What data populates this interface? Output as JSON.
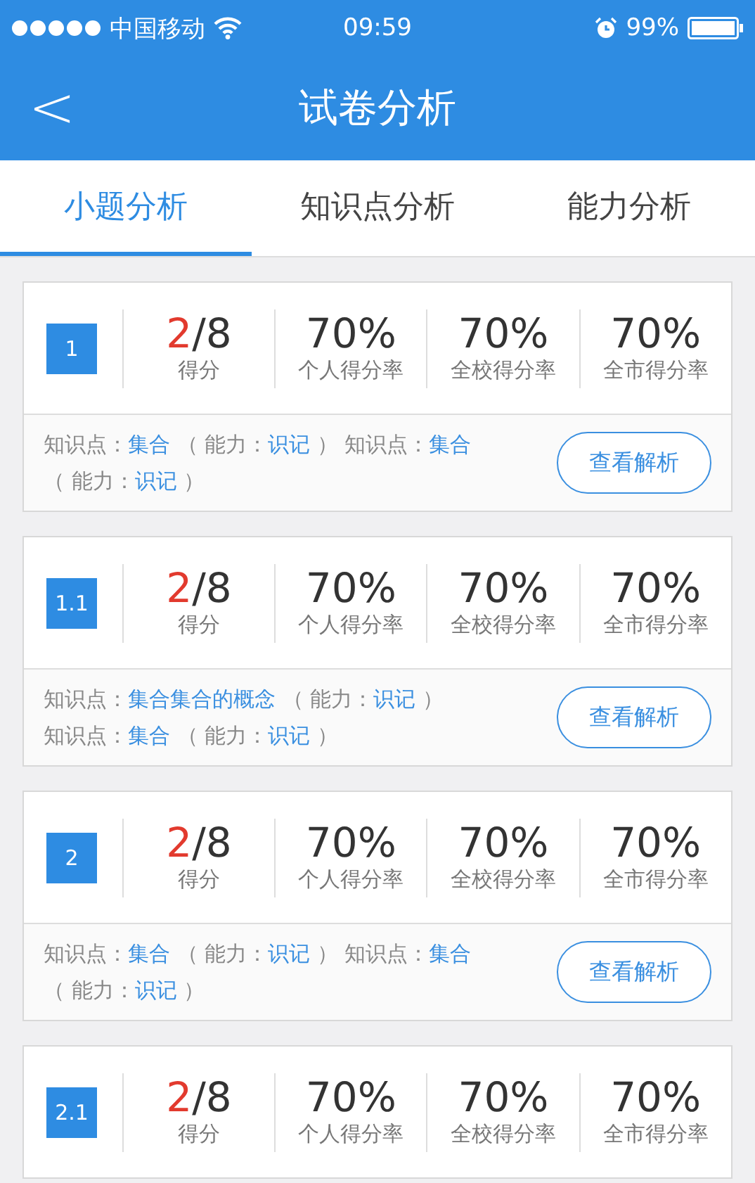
{
  "status_bar": {
    "carrier": "中国移动",
    "time": "09:59",
    "battery": "99%"
  },
  "nav": {
    "back": "<",
    "title": "试卷分析"
  },
  "tabs": [
    {
      "label": "小题分析",
      "selected": true
    },
    {
      "label": "知识点分析",
      "selected": false
    },
    {
      "label": "能力分析",
      "selected": false
    }
  ],
  "questions": [
    {
      "number": "1",
      "score": "2",
      "max": "/8",
      "score_label": "得分",
      "stats": [
        {
          "value": "70%",
          "label": "个人得分率"
        },
        {
          "value": "70%",
          "label": "全校得分率"
        },
        {
          "value": "70%",
          "label": "全市得分率"
        }
      ],
      "lines": [
        [
          {
            "text": "知识点：",
            "kind": "label"
          },
          {
            "text": "集合",
            "kind": "value"
          },
          {
            "text": " （ 能力：",
            "kind": "label"
          },
          {
            "text": "识记",
            "kind": "value"
          },
          {
            "text": " ） 知识点：",
            "kind": "label"
          },
          {
            "text": "集合",
            "kind": "value"
          }
        ],
        [
          {
            "text": "（ 能力：",
            "kind": "label"
          },
          {
            "text": "识记",
            "kind": "value"
          },
          {
            "text": " ）",
            "kind": "label"
          }
        ]
      ],
      "button": "查看解析"
    },
    {
      "number": "1.1",
      "score": "2",
      "max": "/8",
      "score_label": "得分",
      "stats": [
        {
          "value": "70%",
          "label": "个人得分率"
        },
        {
          "value": "70%",
          "label": "全校得分率"
        },
        {
          "value": "70%",
          "label": "全市得分率"
        }
      ],
      "lines": [
        [
          {
            "text": "知识点：",
            "kind": "label"
          },
          {
            "text": "集合集合的概念",
            "kind": "value"
          },
          {
            "text": " （ 能力：",
            "kind": "label"
          },
          {
            "text": "识记",
            "kind": "value"
          },
          {
            "text": " ）",
            "kind": "label"
          }
        ],
        [
          {
            "text": "知识点：",
            "kind": "label"
          },
          {
            "text": "集合",
            "kind": "value"
          },
          {
            "text": " （ 能力：",
            "kind": "label"
          },
          {
            "text": "识记",
            "kind": "value"
          },
          {
            "text": " ）",
            "kind": "label"
          }
        ]
      ],
      "button": "查看解析"
    },
    {
      "number": "2",
      "score": "2",
      "max": "/8",
      "score_label": "得分",
      "stats": [
        {
          "value": "70%",
          "label": "个人得分率"
        },
        {
          "value": "70%",
          "label": "全校得分率"
        },
        {
          "value": "70%",
          "label": "全市得分率"
        }
      ],
      "lines": [
        [
          {
            "text": "知识点：",
            "kind": "label"
          },
          {
            "text": "集合",
            "kind": "value"
          },
          {
            "text": " （ 能力：",
            "kind": "label"
          },
          {
            "text": "识记",
            "kind": "value"
          },
          {
            "text": " ） 知识点：",
            "kind": "label"
          },
          {
            "text": "集合",
            "kind": "value"
          }
        ],
        [
          {
            "text": "（ 能力：",
            "kind": "label"
          },
          {
            "text": "识记",
            "kind": "value"
          },
          {
            "text": " ）",
            "kind": "label"
          }
        ]
      ],
      "button": "查看解析"
    },
    {
      "number": "2.1",
      "score": "2",
      "max": "/8",
      "score_label": "得分",
      "stats": [
        {
          "value": "70%",
          "label": "个人得分率"
        },
        {
          "value": "70%",
          "label": "全校得分率"
        },
        {
          "value": "70%",
          "label": "全市得分率"
        }
      ]
    }
  ]
}
